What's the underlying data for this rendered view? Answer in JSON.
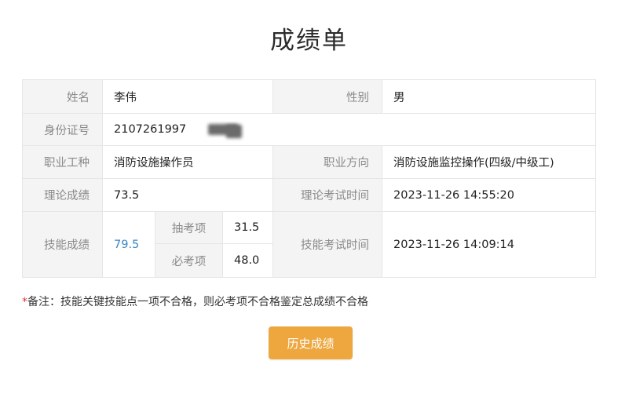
{
  "page": {
    "title": "成绩单",
    "accent_color": "#eda73e",
    "link_color": "#3b86c4"
  },
  "info": {
    "name_label": "姓名",
    "name_value": "李伟",
    "gender_label": "性别",
    "gender_value": "男",
    "id_label": "身份证号",
    "id_value": "2107261997",
    "occupation_label": "职业工种",
    "occupation_value": "消防设施操作员",
    "direction_label": "职业方向",
    "direction_value": "消防设施监控操作(四级/中级工)",
    "theory_score_label": "理论成绩",
    "theory_score_value": "73.5",
    "theory_time_label": "理论考试时间",
    "theory_time_value": "2023-11-26 14:55:20",
    "skill_score_label": "技能成绩",
    "skill_score_value": "79.5",
    "sampled_label": "抽考项",
    "sampled_value": "31.5",
    "required_label": "必考项",
    "required_value": "48.0",
    "skill_time_label": "技能考试时间",
    "skill_time_value": "2023-11-26 14:09:14"
  },
  "note": {
    "star": "*",
    "text": "备注：技能关键技能点一项不合格，则必考项不合格鉴定总成绩不合格"
  },
  "actions": {
    "history_label": "历史成绩"
  }
}
